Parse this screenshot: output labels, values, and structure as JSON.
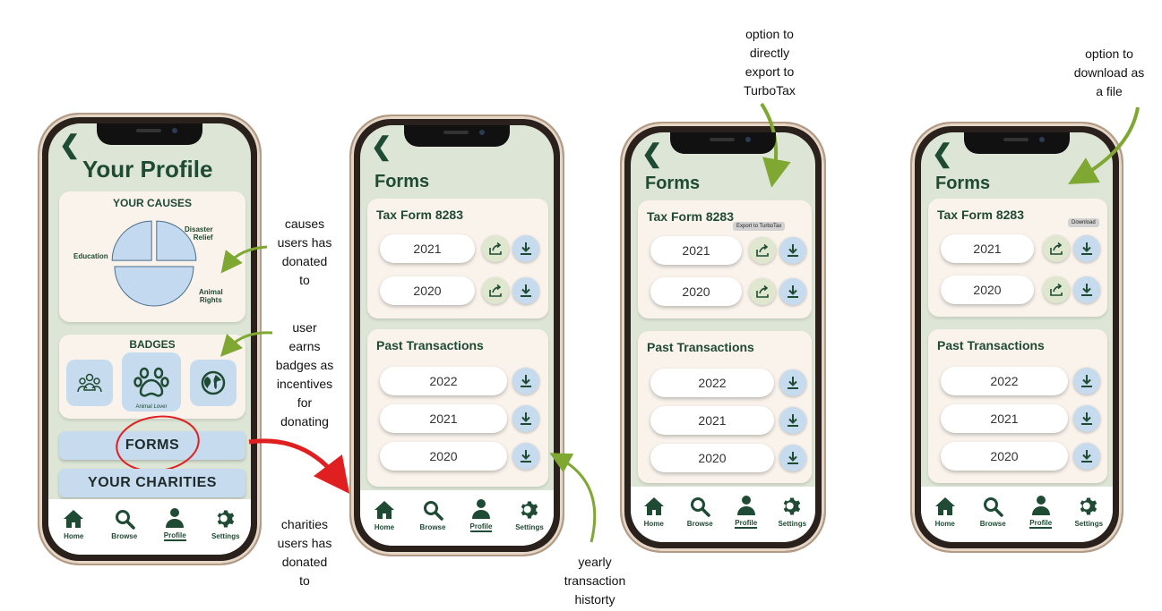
{
  "colors": {
    "brand_green": "#1f4a33",
    "screen_bg": "#dde6d6",
    "card_bg": "#faf3ec",
    "accent_blue": "#c6dbee",
    "arrow_green": "#7ea832",
    "arrow_red": "#e02020"
  },
  "nav": {
    "home": "Home",
    "browse": "Browse",
    "profile": "Profile",
    "settings": "Settings"
  },
  "profile": {
    "title": "Your Profile",
    "causes_title": "YOUR CAUSES",
    "pie_labels": {
      "disaster": "Disaster\nRelief",
      "education": "Education",
      "animal": "Animal\nRights"
    },
    "causes_chart": {
      "type": "pie",
      "categories": [
        "Disaster Relief",
        "Education",
        "Animal Rights"
      ],
      "values": [
        25,
        50,
        25
      ]
    },
    "badges_title": "BADGES",
    "badge_label": "Animal Lover",
    "forms_button": "FORMS",
    "charities_button": "YOUR CHARITIES"
  },
  "forms": {
    "title": "Forms",
    "tax_title": "Tax Form 8283",
    "tax_years": [
      "2021",
      "2020"
    ],
    "past_title": "Past Transactions",
    "past_years": [
      "2022",
      "2021",
      "2020"
    ],
    "export_tooltip": "Export to TurboTax",
    "download_tooltip": "Download"
  },
  "notes": {
    "causes": "causes\nusers has\ndonated\nto",
    "badges": "user\nearns\nbadges as\nincentives\nfor\ndonating",
    "charities": "charities\nusers has\ndonated\nto",
    "yearly": "yearly\ntransaction\nhistorty",
    "export": "option to\ndirectly\nexport to\nTurboTax",
    "download": "option to\ndownload as\na file"
  }
}
